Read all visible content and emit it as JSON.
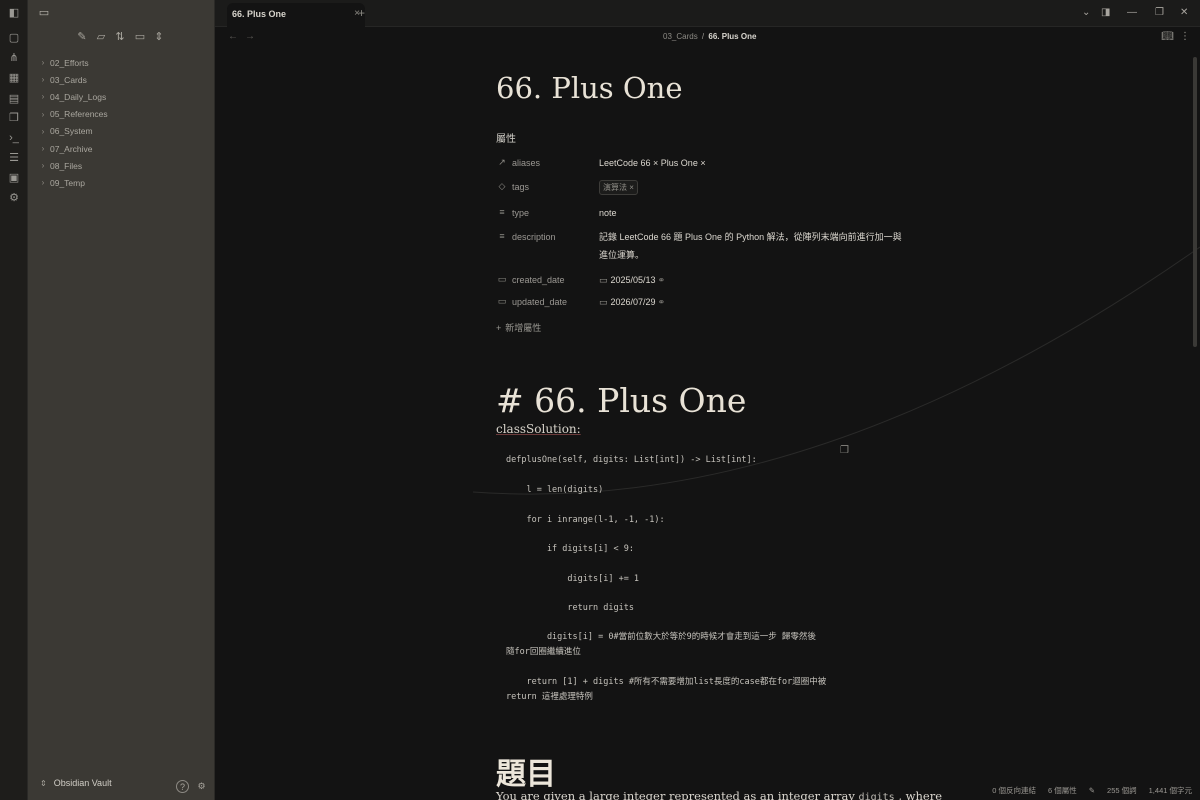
{
  "ribbon": {
    "icons": [
      "sidebar-toggle-icon",
      "file-icon",
      "graph-icon",
      "canvas-icon",
      "calendar-icon",
      "copy-icon",
      "terminal-icon",
      "list-icon",
      "image-icon",
      "tune-icon"
    ]
  },
  "sidebar": {
    "tree": [
      {
        "label": "02_Efforts"
      },
      {
        "label": "03_Cards"
      },
      {
        "label": "04_Daily_Logs"
      },
      {
        "label": "05_References"
      },
      {
        "label": "06_System"
      },
      {
        "label": "07_Archive"
      },
      {
        "label": "08_Files"
      },
      {
        "label": "09_Temp"
      }
    ],
    "vault_name": "Obsidian Vault"
  },
  "tabs": [
    {
      "title": "66. Plus One",
      "active": true
    }
  ],
  "breadcrumb": {
    "folder": "03_Cards",
    "separator": "/",
    "current": "66. Plus One"
  },
  "note": {
    "title": "66. Plus One",
    "properties_heading": "屬性",
    "properties": {
      "aliases": {
        "key": "aliases",
        "value": "LeetCode 66 ×  Plus One ×"
      },
      "tags": {
        "key": "tags",
        "value": "演算法 ×"
      },
      "type": {
        "key": "type",
        "value": "note"
      },
      "description": {
        "key": "description",
        "value": "記錄 LeetCode 66 題 Plus One 的 Python 解法，從陣列末端向前進行加一與進位運算。"
      },
      "created_date": {
        "key": "created_date",
        "value": "2025/05/13"
      },
      "updated_date": {
        "key": "updated_date",
        "value": "2026/07/29"
      }
    },
    "add_property": "新增屬性",
    "h1": "# 66. Plus One",
    "class_line": "classSolution:",
    "code_lines": [
      "defplusOne(self, digits: List[int]) -> List[int]:",
      "    l = len(digits)",
      "    for i inrange(l-1, -1, -1):",
      "        if digits[i] < 9:",
      "            digits[i] += 1",
      "            return digits",
      "        digits[i] = 0#當前位數大於等於9的時候才會走到這一步 歸零然後",
      "隨for回圈繼續進位",
      "    return [1] + digits #所有不需要增加list長度的case都在for迴圈中被",
      "return 這裡處理特例"
    ],
    "h2": "題目",
    "paragraph_start": "You are given a large integer represented as an integer array ",
    "paragraph_code": "digits",
    "paragraph_end": " , where"
  },
  "status_bar": {
    "backlinks": "0 個反向連結",
    "properties": "6 個屬性",
    "words": "255 個詞",
    "chars": "1,441 個字元"
  },
  "colors": {
    "background": "#131313",
    "sidebar": "#3b3934",
    "ribbon": "#1e1d1b",
    "heading": "#e8e2d6"
  }
}
